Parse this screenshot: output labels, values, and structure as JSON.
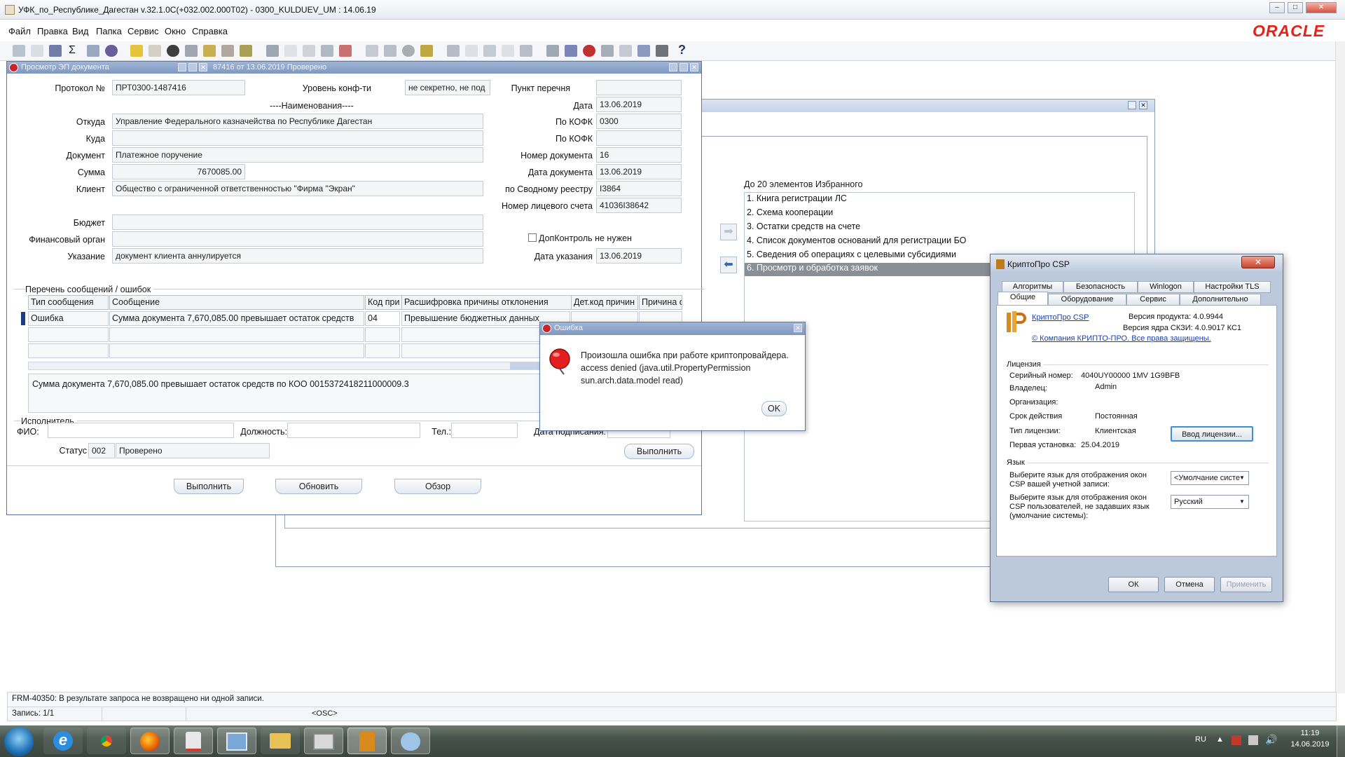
{
  "window": {
    "title": "УФК_по_Республике_Дагестан v.32.1.0C(+032.002.000T02) - 0300_KULDUEV_UM : 14.06.19",
    "brand": "ORACLE",
    "brand_color": "#e2231a"
  },
  "menu": [
    "Файл",
    "Правка",
    "Вид",
    "Папка",
    "Сервис",
    "Окно",
    "Справка"
  ],
  "favorites": {
    "title": "До 20 элементов Избранного",
    "items": [
      "1. Книга регистрации ЛС",
      "2. Схема кооперации",
      "3. Остатки средств на счете",
      "4. Список документов оснований для регистрации БО",
      "5. Сведения об операциях с целевыми субсидиями",
      "6. Просмотр и обработка заявок"
    ]
  },
  "form": {
    "title": "Просмотр ЭП документа",
    "title2": "87416 от 13.06.2019 Проверено",
    "protocol_label": "Протокол №",
    "protocol_value": "ПРТ0300-1487416",
    "conf_label": "Уровень конф-ти",
    "conf_value": "не секретно, не под",
    "point_label": "Пункт перечня",
    "point_value": "",
    "names_header": "----Наименования----",
    "date_label": "Дата",
    "date_value": "13.06.2019",
    "from_label": "Откуда",
    "from_value": "Управление Федерального казначейства по Республике Дагестан",
    "kofk1_label": "По КОФК",
    "kofk1_value": "0300",
    "to_label": "Куда",
    "to_value": "",
    "kofk2_label": "По КОФК",
    "kofk2_value": "",
    "doc_label": "Документ",
    "doc_value": "Платежное поручение",
    "docnum_label": "Номер документа",
    "docnum_value": "16",
    "sum_label": "Сумма",
    "sum_value": "7670085.00",
    "docdate_label": "Дата документа",
    "docdate_value": "13.06.2019",
    "client_label": "Клиент",
    "client_value": "Общество с ограниченной ответственностью \"Фирма \"Экран\"",
    "registry_label": "по Сводному реестру",
    "registry_value": "I3864",
    "account_label": "Номер лицевого счета",
    "account_value": "41036I38642",
    "budget_label": "Бюджет",
    "budget_value": "",
    "finorg_label": "Финансовый орган",
    "finorg_value": "",
    "extra_control": "ДопКонтроль не нужен",
    "instruction_label": "Указание",
    "instruction_value": "документ клиента аннулируется",
    "instrdate_label": "Дата указания",
    "instrdate_value": "13.06.2019",
    "messages_header": "Перечень сообщений / ошибок",
    "columns": [
      "Тип сообщения",
      "Сообщение",
      "Код при",
      "Расшифровка причины отклонения",
      "Дет.код причин",
      "Причина о"
    ],
    "row": [
      "Ошибка",
      "Сумма документа 7,670,085.00 превышает остаток средств",
      "04",
      "Превышение бюджетных данных",
      "",
      ""
    ],
    "message_text": "Сумма документа 7,670,085.00 превышает остаток средств по КОО 0015372418211000009.3",
    "executor_header": "Исполнитель",
    "fio_label": "ФИО:",
    "position_label": "Должность:",
    "phone_label": "Тел.:",
    "signdate_label": "Дата подписания:",
    "status_label": "Статус",
    "status_code": "002",
    "status_value": "Проверено",
    "execute_btn": "Выполнить",
    "btn_execute": "Выполнить",
    "btn_refresh": "Обновить",
    "btn_browse": "Обзор"
  },
  "error": {
    "title": "Ошибка",
    "line1": "Произошла ошибка при работе криптопровайдера.",
    "line2": "access denied (java.util.PropertyPermission",
    "line3": "sun.arch.data.model read)",
    "ok": "OK"
  },
  "cryptopro": {
    "title": "КриптоПро CSP",
    "tabs_row1": [
      "Алгоритмы",
      "Безопасность",
      "Winlogon",
      "Настройки TLS"
    ],
    "tabs_row2": [
      "Общие",
      "Оборудование",
      "Сервис",
      "Дополнительно"
    ],
    "product_link": "КриптоПро CSP",
    "product_version": "Версия продукта: 4.0.9944",
    "core_version": "Версия ядра СКЗИ: 4.0.9017 КС1",
    "copyright": "© Компания КРИПТО-ПРО. Все права защищены.",
    "license_header": "Лицензия",
    "serial_label": "Серийный номер:",
    "serial_value": "4040UY00000 1MV 1G9BFB",
    "owner_label": "Владелец:",
    "owner_value": "Admin",
    "org_label": "Организация:",
    "org_value": "",
    "term_label": "Срок действия",
    "term_value": "Постоянная",
    "type_label": "Тип лицензии:",
    "type_value": "Клиентская",
    "install_label": "Первая установка:",
    "install_value": "25.04.2019",
    "enter_license": "Ввод лицензии...",
    "lang_header": "Язык",
    "lang1_label1": "Выберите язык для отображения окон",
    "lang1_label2": "CSP вашей учетной записи:",
    "lang1_value": "<Умолчание систе",
    "lang2_label1": "Выберите язык для отображения окон",
    "lang2_label2": "CSP пользователей, не задавших язык",
    "lang2_label3": "(умолчание системы):",
    "lang2_value": "Русский",
    "ok": "ОК",
    "cancel": "Отмена",
    "apply": "Применить"
  },
  "status": {
    "message": "FRM-40350: В результате запроса не возвращено ни одной записи.",
    "record": "Запись: 1/1",
    "osc": "<OSC>"
  },
  "taskbar": {
    "lang": "RU",
    "time": "11:19",
    "date": "14.06.2019"
  }
}
